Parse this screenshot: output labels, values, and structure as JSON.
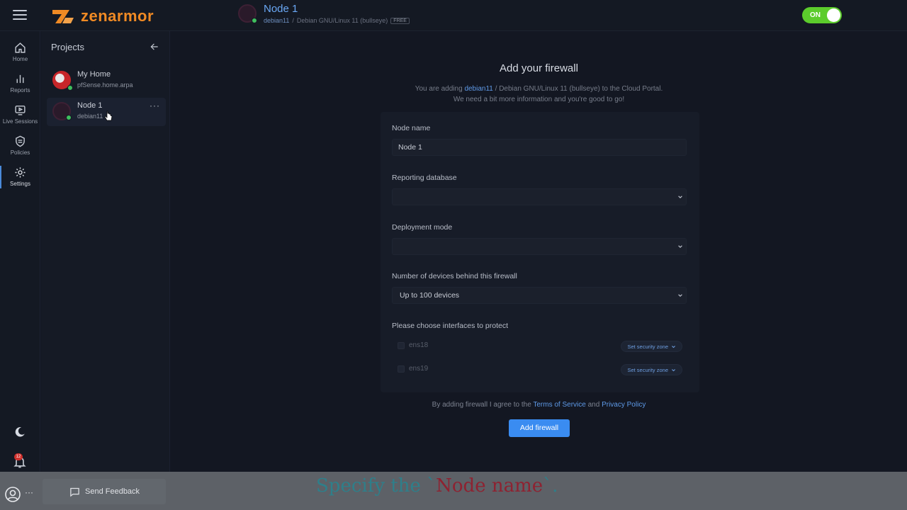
{
  "brand": {
    "name": "zenarmor",
    "color": "#f08a24"
  },
  "header": {
    "node_title": "Node 1",
    "node_hostname": "debian11",
    "node_separator": "/",
    "node_os": "Debian GNU/Linux 11 (bullseye)",
    "plan_badge": "FREE",
    "toggle_label": "ON",
    "toggle_state": "on"
  },
  "rail": {
    "items": [
      {
        "label": "Home",
        "icon": "home-icon"
      },
      {
        "label": "Reports",
        "icon": "bar-chart-icon"
      },
      {
        "label": "Live Sessions",
        "icon": "play-screen-icon"
      },
      {
        "label": "Policies",
        "icon": "shield-icon"
      },
      {
        "label": "Settings",
        "icon": "gear-icon",
        "active": true
      }
    ],
    "notifications_count": "12"
  },
  "projects": {
    "title": "Projects",
    "items": [
      {
        "name": "My Home",
        "host": "pfSense.home.arpa",
        "online": true
      },
      {
        "name": "Node 1",
        "host": "debian11",
        "online": true,
        "selected": true
      }
    ]
  },
  "form": {
    "title": "Add your firewall",
    "desc_prefix": "You are adding ",
    "desc_host": "debian11",
    "desc_middle": " / Debian GNU/Linux 11 (bullseye) to the Cloud Portal.",
    "desc_line2": "We need a bit more information and you're good to go!",
    "node_name_label": "Node name",
    "node_name_value": "Node 1",
    "reporting_db_label": "Reporting database",
    "reporting_db_value": "",
    "deployment_label": "Deployment mode",
    "deployment_value": "",
    "devices_label": "Number of devices behind this firewall",
    "devices_value": "Up to 100 devices",
    "interfaces_label": "Please choose interfaces to protect",
    "interfaces": [
      {
        "name": "ens18",
        "zone_label": "Set security zone"
      },
      {
        "name": "ens19",
        "zone_label": "Set security zone"
      }
    ],
    "agree_prefix": "By adding firewall I agree to the ",
    "terms_link": "Terms of Service",
    "agree_and": " and ",
    "privacy_link": "Privacy Policy",
    "submit_label": "Add firewall"
  },
  "footer": {
    "feedback_label": "Send Feedback",
    "user_more": "···"
  },
  "caption": {
    "prefix": "Specify the `",
    "highlight": "Node name",
    "suffix": "`."
  }
}
